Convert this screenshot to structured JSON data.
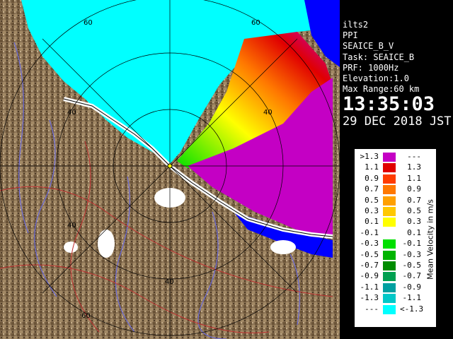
{
  "station": "ilts2",
  "mode": "PPI",
  "product": "SEAICE_B_V",
  "task": "Task: SEAICE_B",
  "prf": "PRF: 1000Hz",
  "elevation": "Elevation:1.0",
  "max_range": "Max Range:60 km",
  "time": "13:35:03",
  "date": "29 DEC 2018 JST",
  "legend": {
    "title": "Mean Velocity in m/s",
    "rows": [
      {
        "lo": ">1.3",
        "hi": "---",
        "color": "#c400c4"
      },
      {
        "lo": "1.1",
        "hi": "1.3",
        "color": "#e00000"
      },
      {
        "lo": "0.9",
        "hi": "1.1",
        "color": "#ff3c00"
      },
      {
        "lo": "0.7",
        "hi": "0.9",
        "color": "#ff7800"
      },
      {
        "lo": "0.5",
        "hi": "0.7",
        "color": "#ffa000"
      },
      {
        "lo": "0.3",
        "hi": "0.5",
        "color": "#ffc800"
      },
      {
        "lo": "0.1",
        "hi": "0.3",
        "color": "#ffff00"
      },
      {
        "lo": "-0.1",
        "hi": "0.1",
        "color": "#ffffff"
      },
      {
        "lo": "-0.3",
        "hi": "-0.1",
        "color": "#00e000"
      },
      {
        "lo": "-0.5",
        "hi": "-0.3",
        "color": "#00b400"
      },
      {
        "lo": "-0.7",
        "hi": "-0.5",
        "color": "#008c00"
      },
      {
        "lo": "-0.9",
        "hi": "-0.7",
        "color": "#00a050"
      },
      {
        "lo": "-1.1",
        "hi": "-0.9",
        "color": "#00a0a0"
      },
      {
        "lo": "-1.3",
        "hi": "-1.1",
        "color": "#00c8c8"
      },
      {
        "lo": "---",
        "hi": "<-1.3",
        "color": "#00ffff"
      }
    ]
  },
  "ring_labels": [
    "60",
    "60",
    "40",
    "40",
    "40",
    "40",
    "60"
  ],
  "colors": {
    "sea_ice_far": "#00ffff",
    "approaching": "#c400c4",
    "land": "#8b7355",
    "coast": "#ffffff",
    "open_water": "#0000ff"
  }
}
